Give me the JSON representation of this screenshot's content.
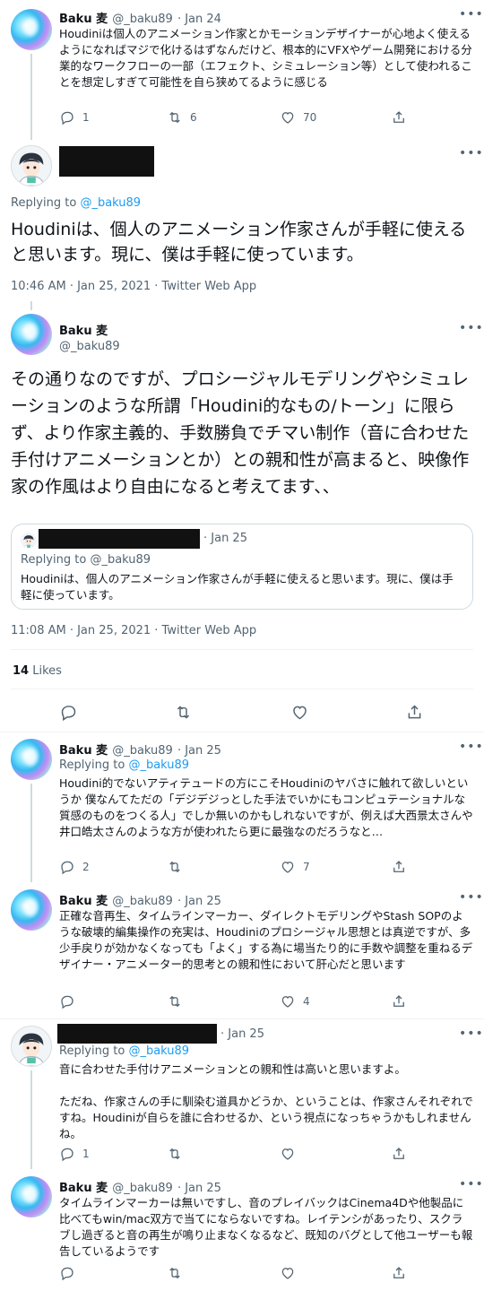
{
  "tweet1": {
    "name": "Baku 麦",
    "handle": "@_baku89",
    "date": "· Jan 24",
    "text": "Houdiniは個人のアニメーション作家とかモーションデザイナーが心地よく使えるようになればマジで化けるはずなんだけど、根本的にVFXやゲーム開発における分業的なワークフローの一部（エフェクト、シミュレーション等）として使われることを想定しすぎて可能性を自ら狭めてるように感じる",
    "replies": "1",
    "retweets": "6",
    "likes": "70"
  },
  "tweet2": {
    "replying_label": "Replying to",
    "replying_handle": "@_baku89",
    "text": "Houdiniは、個人のアニメーション作家さんが手軽に使えると思います。現に、僕は手軽に使っています。",
    "timestamp": "10:46 AM · Jan 25, 2021 · Twitter Web App"
  },
  "main": {
    "name": "Baku 麦",
    "handle": "@_baku89",
    "text": "その通りなのですが、プロシージャルモデリングやシミュレーションのような所謂「Houdini的なもの/トーン」に限らず、より作家主義的、手数勝負でチマい制作（音に合わせた手付けアニメーションとか）との親和性が高まると、映像作家の作風はより自由になると考えてます、、",
    "quote": {
      "date": "· Jan 25",
      "replying_label": "Replying to",
      "replying_handle": "@_baku89",
      "text": "Houdiniは、個人のアニメーション作家さんが手軽に使えると思います。現に、僕は手軽に使っています。"
    },
    "timestamp": "11:08 AM · Jan 25, 2021 · Twitter Web App",
    "likes_count": "14",
    "likes_label": "Likes"
  },
  "reply1": {
    "name": "Baku 麦",
    "handle": "@_baku89",
    "date": "· Jan 25",
    "replying_label": "Replying to",
    "replying_handle": "@_baku89",
    "text": "Houdini的でないアティテュードの方にこそHoudiniのヤバさに触れて欲しいというか 僕なんてただの「デジデジっとした手法でいかにもコンピュテーショナルな質感のものをつくる人」でしか無いのかもしれないですが、例えば大西景太さんや井口皓太さんのような方が使われたら更に最強なのだろうなと…",
    "replies": "2",
    "likes": "7"
  },
  "reply2": {
    "name": "Baku 麦",
    "handle": "@_baku89",
    "date": "· Jan 25",
    "text": "正確な音再生、タイムラインマーカー、ダイレクトモデリングやStash SOPのような破壊的編集操作の充実は、Houdiniのプロシージャル思想とは真逆ですが、多少手戻りが効かなくなっても「よく」する為に場当たり的に手数や調整を重ねるデザイナー・アニメーター的思考との親和性において肝心だと思います",
    "likes": "4"
  },
  "reply3": {
    "date": "· Jan 25",
    "replying_label": "Replying to",
    "replying_handle": "@_baku89",
    "text": "音に合わせた手付けアニメーションとの親和性は高いと思いますよ。\n\nただね、作家さんの手に馴染む道具かどうか、ということは、作家さんそれぞれですね。Houdiniが自らを誰に合わせるか、という視点になっちゃうかもしれませんね。",
    "replies": "1"
  },
  "reply4": {
    "name": "Baku 麦",
    "handle": "@_baku89",
    "date": "· Jan 25",
    "text": "タイムラインマーカーは無いですし、音のプレイバックはCinema4Dや他製品に比べてもwin/mac双方で当てにならないですね。レイテンシがあったり、スクラブし過ぎると音の再生が鳴り止まなくなるなど、既知のバグとして他ユーザーも報告しているようです"
  },
  "more_label": "•••",
  "colors": {
    "accent": "#1d9bf0",
    "muted": "#536471",
    "like_red": "#f91880"
  }
}
